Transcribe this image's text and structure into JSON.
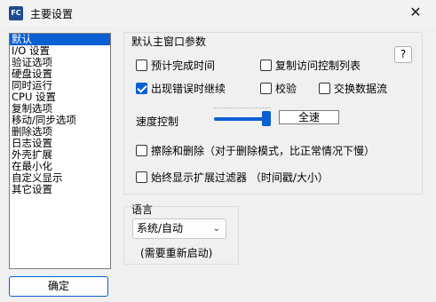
{
  "window": {
    "app_icon_text": "FC",
    "title": "主要设置",
    "close_glyph": "✕"
  },
  "categories": [
    {
      "label": "默认",
      "selected": true
    },
    {
      "label": "I/O 设置"
    },
    {
      "label": "验证选项"
    },
    {
      "label": "硬盘设置"
    },
    {
      "label": "同时运行"
    },
    {
      "label": "CPU 设置"
    },
    {
      "label": "复制选项"
    },
    {
      "label": "移动/同步选项"
    },
    {
      "label": "删除选项"
    },
    {
      "label": "日志设置"
    },
    {
      "label": "外壳扩展"
    },
    {
      "label": "在最小化"
    },
    {
      "label": "自定义显示"
    },
    {
      "label": "其它设置"
    }
  ],
  "ok_button": "确定",
  "main_group": {
    "title": "默认主窗口参数",
    "help": "?",
    "options": {
      "estimate_time": {
        "label": "预计完成时间",
        "checked": false
      },
      "copy_acl": {
        "label": "复制访问控制列表",
        "checked": false
      },
      "continue_on_error": {
        "label": "出现错误时继续",
        "checked": true
      },
      "verify": {
        "label": "校验",
        "checked": false
      },
      "swap_streams": {
        "label": "交换数据流",
        "checked": false
      },
      "wipe_delete": {
        "label": "擦除和删除（对于删除模式，比正常情况下慢）",
        "checked": false
      },
      "show_filter": {
        "label": "始终显示扩展过滤器 （时间戳/大小）",
        "checked": false
      }
    },
    "speed_label": "速度控制",
    "speed_level": 1.0,
    "speed_value": "全速"
  },
  "language_group": {
    "title": "语言",
    "selected": "系统/自动",
    "note": "(需要重新启动)"
  },
  "colors": {
    "accent": "#0a5fd3"
  }
}
